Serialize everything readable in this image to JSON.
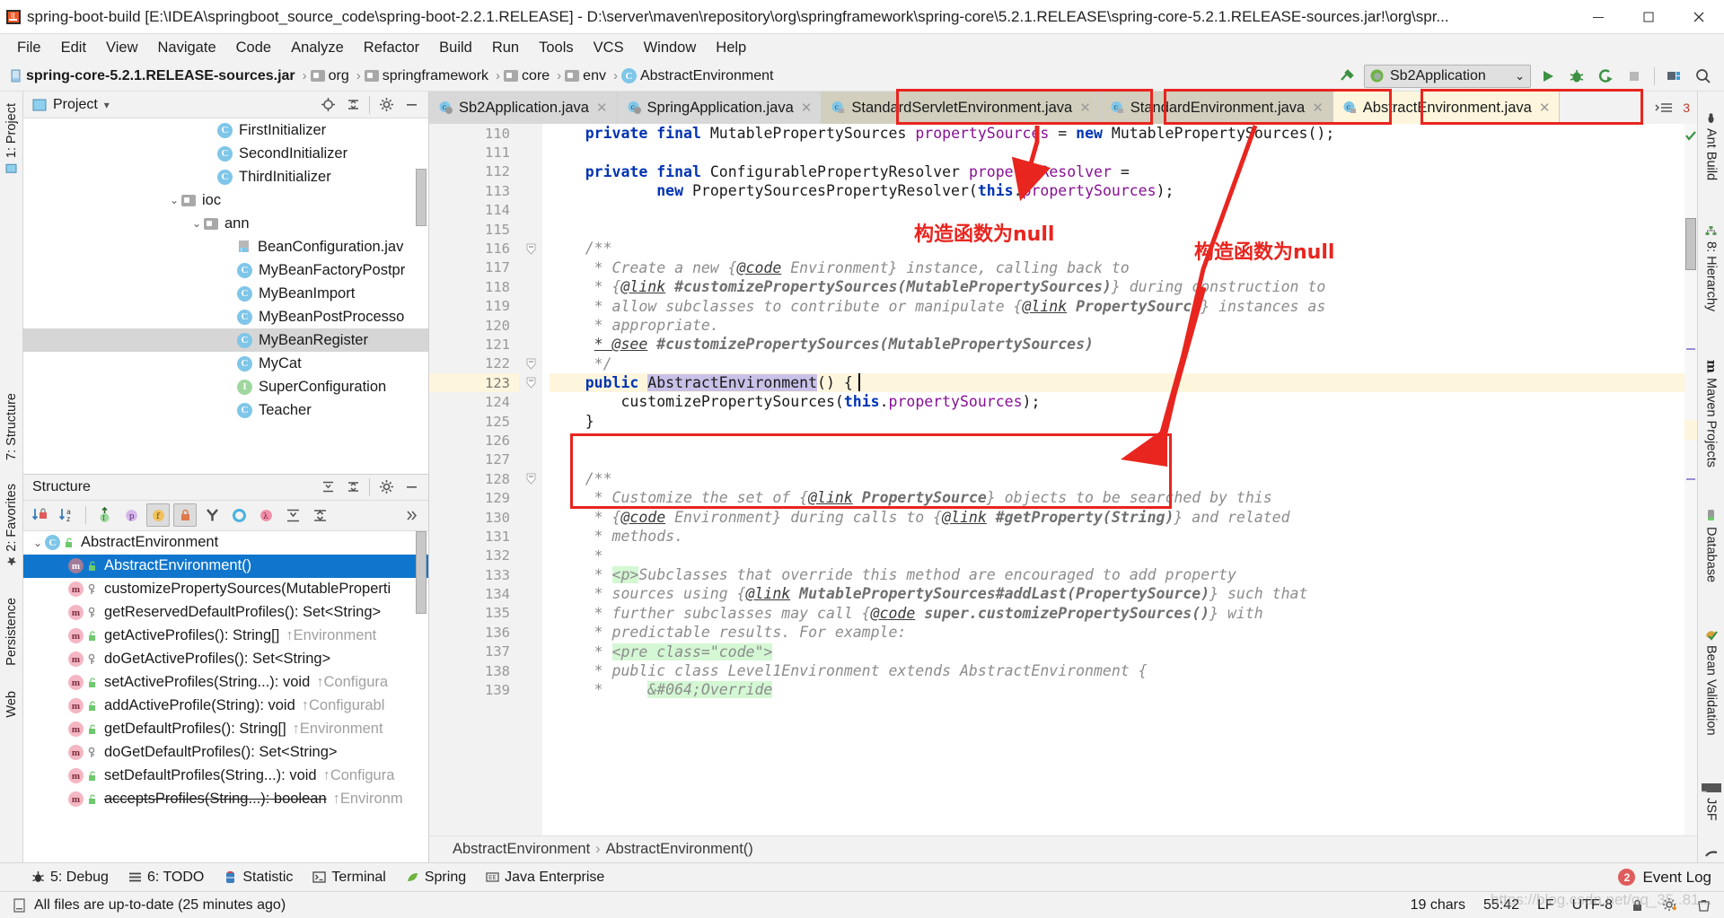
{
  "window": {
    "title": "spring-boot-build [E:\\IDEA\\springboot_source_code\\spring-boot-2.2.1.RELEASE] - D:\\server\\maven\\repository\\org\\springframework\\spring-core\\5.2.1.RELEASE\\spring-core-5.2.1.RELEASE-sources.jar!\\org\\spr...",
    "minimize": "—",
    "maximize": "❐",
    "close": "✕"
  },
  "menu": [
    "File",
    "Edit",
    "View",
    "Navigate",
    "Code",
    "Analyze",
    "Refactor",
    "Build",
    "Run",
    "Tools",
    "VCS",
    "Window",
    "Help"
  ],
  "navbar": {
    "crumbs": [
      "spring-core-5.2.1.RELEASE-sources.jar",
      "org",
      "springframework",
      "core",
      "env",
      "AbstractEnvironment"
    ],
    "separator": "›",
    "run_config": "Sb2Application",
    "dropdown_caret": "⌄"
  },
  "editor_tabs": [
    {
      "label": "Sb2Application.java",
      "state": "inactive",
      "boxed": false,
      "close": "✕"
    },
    {
      "label": "SpringApplication.java",
      "state": "inactive",
      "boxed": false,
      "close": "✕"
    },
    {
      "label": "StandardServletEnvironment.java",
      "state": "inactive2",
      "boxed": true,
      "close": "✕"
    },
    {
      "label": "StandardEnvironment.java",
      "state": "inactive2",
      "boxed": true,
      "close": "✕"
    },
    {
      "label": "AbstractEnvironment.java",
      "state": "active",
      "boxed": true,
      "close": "✕"
    }
  ],
  "tab_overflow": "3",
  "project_panel": {
    "title": "Project",
    "caret": "▾",
    "items": [
      {
        "label": "FirstInitializer",
        "indent": 200,
        "icon": "class",
        "selected": false,
        "arrow": ""
      },
      {
        "label": "SecondInitializer",
        "indent": 200,
        "icon": "class",
        "selected": false,
        "arrow": ""
      },
      {
        "label": "ThirdInitializer",
        "indent": 200,
        "icon": "class",
        "selected": false,
        "arrow": ""
      },
      {
        "label": "ioc",
        "indent": 160,
        "icon": "folder",
        "selected": false,
        "arrow": "⌄"
      },
      {
        "label": "ann",
        "indent": 185,
        "icon": "folder",
        "selected": false,
        "arrow": "⌄"
      },
      {
        "label": "BeanConfiguration.jav",
        "indent": 222,
        "icon": "javafile",
        "selected": false,
        "arrow": ""
      },
      {
        "label": "MyBeanFactoryPostpr",
        "indent": 222,
        "icon": "class",
        "selected": false,
        "arrow": ""
      },
      {
        "label": "MyBeanImport",
        "indent": 222,
        "icon": "class",
        "selected": false,
        "arrow": ""
      },
      {
        "label": "MyBeanPostProcesso",
        "indent": 222,
        "icon": "class",
        "selected": false,
        "arrow": ""
      },
      {
        "label": "MyBeanRegister",
        "indent": 222,
        "icon": "class",
        "selected": true,
        "arrow": ""
      },
      {
        "label": "MyCat",
        "indent": 222,
        "icon": "class",
        "selected": false,
        "arrow": ""
      },
      {
        "label": "SuperConfiguration",
        "indent": 222,
        "icon": "interface",
        "selected": false,
        "arrow": ""
      },
      {
        "label": "Teacher",
        "indent": 222,
        "icon": "class",
        "selected": false,
        "arrow": ""
      }
    ]
  },
  "structure_panel": {
    "title": "Structure",
    "items": [
      {
        "label": "AbstractEnvironment",
        "suffix": "",
        "indent": 8,
        "icon": "class",
        "vis": "protected",
        "selected": false,
        "arrow": "⌄",
        "strike": false
      },
      {
        "label": "AbstractEnvironment()",
        "suffix": "",
        "indent": 50,
        "icon": "method",
        "vis": "protected",
        "selected": true,
        "arrow": "",
        "strike": false
      },
      {
        "label": "customizePropertySources(MutableProperti",
        "suffix": "",
        "indent": 50,
        "icon": "method",
        "vis": "key",
        "selected": false,
        "arrow": "",
        "strike": false
      },
      {
        "label": "getReservedDefaultProfiles(): Set<String>",
        "suffix": "",
        "indent": 50,
        "icon": "method",
        "vis": "key",
        "selected": false,
        "arrow": "",
        "strike": false
      },
      {
        "label": "getActiveProfiles(): String[]",
        "suffix": "↑Environment",
        "indent": 50,
        "icon": "method",
        "vis": "protected",
        "selected": false,
        "arrow": "",
        "strike": false
      },
      {
        "label": "doGetActiveProfiles(): Set<String>",
        "suffix": "",
        "indent": 50,
        "icon": "method",
        "vis": "key",
        "selected": false,
        "arrow": "",
        "strike": false
      },
      {
        "label": "setActiveProfiles(String...): void",
        "suffix": "↑Configura",
        "indent": 50,
        "icon": "method",
        "vis": "protected",
        "selected": false,
        "arrow": "",
        "strike": false
      },
      {
        "label": "addActiveProfile(String): void",
        "suffix": "↑Configurabl",
        "indent": 50,
        "icon": "method",
        "vis": "protected",
        "selected": false,
        "arrow": "",
        "strike": false
      },
      {
        "label": "getDefaultProfiles(): String[]",
        "suffix": "↑Environment",
        "indent": 50,
        "icon": "method",
        "vis": "protected",
        "selected": false,
        "arrow": "",
        "strike": false
      },
      {
        "label": "doGetDefaultProfiles(): Set<String>",
        "suffix": "",
        "indent": 50,
        "icon": "method",
        "vis": "key",
        "selected": false,
        "arrow": "",
        "strike": false
      },
      {
        "label": "setDefaultProfiles(String...): void",
        "suffix": "↑Configura",
        "indent": 50,
        "icon": "method",
        "vis": "protected",
        "selected": false,
        "arrow": "",
        "strike": false
      },
      {
        "label": "acceptsProfiles(String...): boolean",
        "suffix": "↑Environm",
        "indent": 50,
        "icon": "method",
        "vis": "protected",
        "selected": false,
        "arrow": "",
        "strike": true
      }
    ],
    "sort_tools": [
      "sort-by-visibility-icon",
      "sort-alphabetically-icon",
      "show-inherited-icon",
      "show-properties-icon",
      "show-fields-icon",
      "show-non-public-icon",
      "show-anonymous-icon",
      "show-interfaces-icon",
      "show-lambdas-icon",
      "expand-all-icon",
      "collapse-all-icon",
      "more-icon"
    ]
  },
  "code": {
    "first_line": 110,
    "highlight_line": 123,
    "lines": [
      {
        "n": 110,
        "fold": "",
        "html": "    <span class='kw'>private</span> <span class='kw'>final</span> <span class='plain'>MutablePropertySources</span> <span class='fld'>propertySources</span> = <span class='kw'>new</span> <span class='plain'>MutablePropertySources</span>();"
      },
      {
        "n": 111,
        "fold": "",
        "html": ""
      },
      {
        "n": 112,
        "fold": "",
        "html": "    <span class='kw'>private</span> <span class='kw'>final</span> <span class='plain'>ConfigurablePropertyResolver</span> <span class='fld'>propertyResolver</span> ="
      },
      {
        "n": 113,
        "fold": "",
        "html": "            <span class='kw'>new</span> <span class='plain'>PropertySourcesPropertyResolver</span>(<span class='kw'>this</span>.<span class='fld'>propertySources</span>);"
      },
      {
        "n": 114,
        "fold": "",
        "html": ""
      },
      {
        "n": 115,
        "fold": "",
        "html": ""
      },
      {
        "n": 116,
        "fold": "-",
        "html": "    <span class='cmt'>/**</span>"
      },
      {
        "n": 117,
        "fold": "",
        "html": "     <span class='cmt'>* Create a new {</span><span class='tag'>@code</span><span class='cmt'> Environment} instance, calling back to</span>"
      },
      {
        "n": 118,
        "fold": "",
        "html": "     <span class='cmt'>* {</span><span class='tag'>@link</span><span class='cmtb'> #customizePropertySources(MutablePropertySources)</span><span class='cmt'>} during construction to</span>"
      },
      {
        "n": 119,
        "fold": "",
        "html": "     <span class='cmt'>* allow subclasses to contribute or manipulate {</span><span class='tag'>@link</span><span class='cmtb'> PropertySource</span><span class='cmt'>} instances as</span>"
      },
      {
        "n": 120,
        "fold": "",
        "html": "     <span class='cmt'>* appropriate.</span>"
      },
      {
        "n": 121,
        "fold": "",
        "html": "     <span class='tag'>* @see</span><span class='cmtb'> #customizePropertySources(MutablePropertySources)</span>"
      },
      {
        "n": 122,
        "fold": "-",
        "html": "     <span class='cmt'>*/</span>"
      },
      {
        "n": 123,
        "fold": "-",
        "html": "    <span class='kw'>public</span> <span class='sel'>AbstractEnvironment</span>() {"
      },
      {
        "n": 124,
        "fold": "",
        "html": "        customizePropertySources(<span class='kw'>this</span>.<span class='fld'>propertySources</span>);"
      },
      {
        "n": 125,
        "fold": "",
        "html": "    }"
      },
      {
        "n": 126,
        "fold": "",
        "html": ""
      },
      {
        "n": 127,
        "fold": "",
        "html": ""
      },
      {
        "n": 128,
        "fold": "-",
        "html": "    <span class='cmt'>/**</span>"
      },
      {
        "n": 129,
        "fold": "",
        "html": "     <span class='cmt'>* Customize the set of {</span><span class='tag'>@link</span><span class='cmtb'> PropertySource</span><span class='cmt'>} objects to be searched by this</span>"
      },
      {
        "n": 130,
        "fold": "",
        "html": "     <span class='cmt'>* {</span><span class='tag'>@code</span><span class='cmt'> Environment} during calls to {</span><span class='tag'>@link</span><span class='cmtb'> #getProperty(String)</span><span class='cmt'>} and related</span>"
      },
      {
        "n": 131,
        "fold": "",
        "html": "     <span class='cmt'>* methods.</span>"
      },
      {
        "n": 132,
        "fold": "",
        "html": "     <span class='cmt'>*</span>"
      },
      {
        "n": 133,
        "fold": "",
        "html": "     <span class='cmt'>* </span><span class='greenbg cmt'>&lt;p&gt;</span><span class='cmt'>Subclasses that override this method are encouraged to add property</span>"
      },
      {
        "n": 134,
        "fold": "",
        "html": "     <span class='cmt'>* sources using {</span><span class='tag'>@link</span><span class='cmtb'> MutablePropertySources#addLast(PropertySource)</span><span class='cmt'>} such that</span>"
      },
      {
        "n": 135,
        "fold": "",
        "html": "     <span class='cmt'>* further subclasses may call {</span><span class='tag'>@code</span><span class='cmtb'> super.customizePropertySources()</span><span class='cmt'>} with</span>"
      },
      {
        "n": 136,
        "fold": "",
        "html": "     <span class='cmt'>* predictable results. For example:</span>"
      },
      {
        "n": 137,
        "fold": "",
        "html": "     <span class='cmt'>* </span><span class='greenbg cmt'>&lt;pre class=\"code\"&gt;</span>"
      },
      {
        "n": 138,
        "fold": "",
        "html": "     <span class='cmt'>* public class Level1Environment extends AbstractEnvironment {</span>"
      },
      {
        "n": 139,
        "fold": "",
        "html": "     <span class='cmt'>*     </span><span class='greenbg cmt'>&amp;#064;Override</span>"
      }
    ]
  },
  "editor_breadcrumb": {
    "parts": [
      "AbstractEnvironment",
      "AbstractEnvironment()"
    ],
    "separator": "›"
  },
  "left_rail": [
    "1: Project",
    "7: Structure",
    "2: Favorites",
    "Persistence",
    "Web"
  ],
  "right_rail": [
    "Ant Build",
    "8: Hierarchy",
    "Maven Projects",
    "Database",
    "Bean Validation",
    "JSF",
    "Gradle"
  ],
  "tool_windows": [
    {
      "label": "5: Debug",
      "icon": "bug-icon"
    },
    {
      "label": "6: TODO",
      "icon": "list-icon"
    },
    {
      "label": "Statistic",
      "icon": "statistic-icon"
    },
    {
      "label": "Terminal",
      "icon": "terminal-icon"
    },
    {
      "label": "Spring",
      "icon": "spring-leaf-icon"
    },
    {
      "label": "Java Enterprise",
      "icon": "java-enterprise-icon"
    }
  ],
  "status": {
    "message": "All files are up-to-date (25 minutes ago)",
    "event_log": "Event Log",
    "event_count": "2",
    "chars": "19 chars",
    "caret": "55:42",
    "line_sep": "LF",
    "encoding": "UTF-8",
    "watermark": "https://blog.csdn.net/qq_35..81..."
  },
  "annotations": {
    "note1": "构造函数为null",
    "note2": "构造函数为null",
    "accent_red": "#e8251f"
  }
}
